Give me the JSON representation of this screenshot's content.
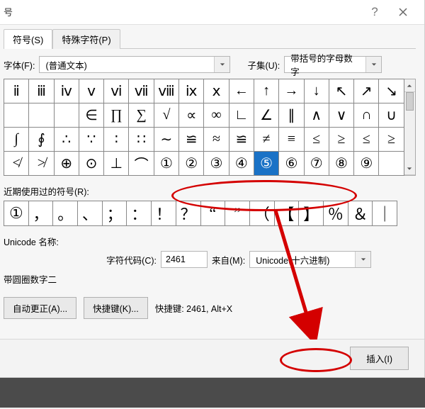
{
  "title": "号",
  "tabs": {
    "symbols": "符号(S)",
    "special": "特殊字符(P)"
  },
  "font": {
    "label": "字体(F):",
    "value": "(普通文本)"
  },
  "subset": {
    "label": "子集(U):",
    "value": "带括号的字母数字"
  },
  "grid": [
    "ⅱ",
    "ⅲ",
    "ⅳ",
    "ⅴ",
    "ⅵ",
    "ⅶ",
    "ⅷ",
    "ⅸ",
    "ⅹ",
    "←",
    "↑",
    "→",
    "↓",
    "↖",
    "↗",
    "↘",
    "∈",
    "∏",
    "∑",
    "√",
    "∝",
    "∞",
    "∟",
    "∠",
    "∥",
    "∧",
    "∨",
    "∩",
    "∪",
    "∫",
    "∮",
    "∴",
    "∵",
    "∶",
    "∷",
    "∼",
    "≌",
    "≈",
    "≌",
    "≠",
    "≡",
    "≤",
    "≥",
    "≤",
    "≥",
    "≮",
    "≯",
    "⊕",
    "⊙",
    "⊥",
    "⌒",
    "①",
    "②",
    "③",
    "④",
    "⑤",
    "⑥",
    "⑦",
    "⑧",
    "⑨"
  ],
  "grid_blanks_row2": [
    0,
    1,
    2
  ],
  "selected_index": 55,
  "recent_label": "近期使用过的符号(R):",
  "recent": [
    "①",
    "，",
    "。",
    "、",
    "；",
    "：",
    "！",
    "？",
    "“",
    "”",
    "（",
    "【",
    "】",
    "％",
    "＆",
    "｜"
  ],
  "unicode_name": {
    "label": "Unicode 名称:",
    "value": "带圆圈数字二"
  },
  "char_code": {
    "label": "字符代码(C):",
    "value": "2461"
  },
  "from": {
    "label": "来自(M):",
    "value": "Unicode(十六进制)"
  },
  "autocorrect": "自动更正(A)...",
  "shortcut_btn": "快捷键(K)...",
  "shortcut_text": "快捷键: 2461, Alt+X",
  "insert": "插入(I)"
}
